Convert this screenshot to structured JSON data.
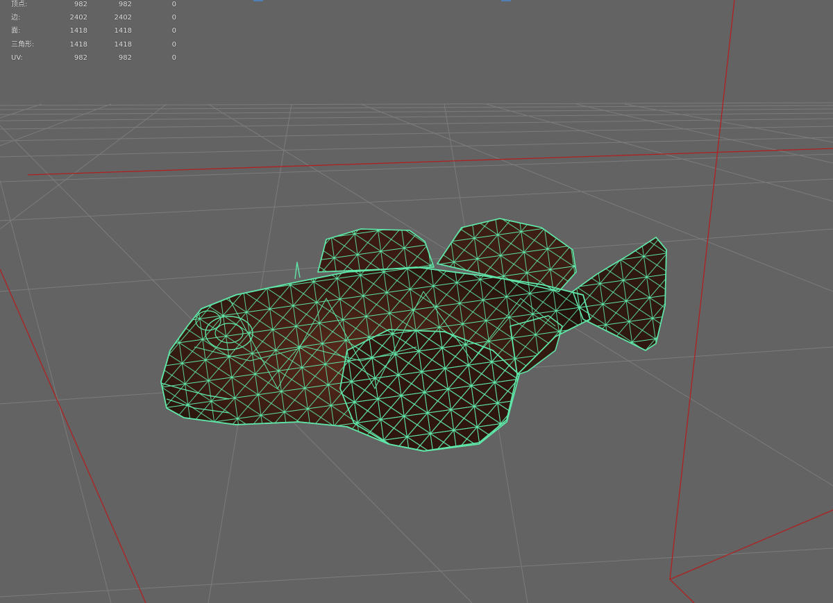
{
  "hud": {
    "rows": [
      {
        "label": "顶点:",
        "v1": "982",
        "v2": "982",
        "v3": "0"
      },
      {
        "label": "边:",
        "v1": "2402",
        "v2": "2402",
        "v3": "0"
      },
      {
        "label": "面:",
        "v1": "1418",
        "v2": "1418",
        "v3": "0"
      },
      {
        "label": "三角形:",
        "v1": "1418",
        "v2": "1418",
        "v3": "0"
      },
      {
        "label": "UV:",
        "v1": "982",
        "v2": "982",
        "v3": "0"
      }
    ]
  },
  "colors": {
    "background": "#636363",
    "grid": "#7a7a7a",
    "axis": "#b02020",
    "wireframe": "#5fe6a8",
    "mesh_fill": "#3a1e14"
  }
}
